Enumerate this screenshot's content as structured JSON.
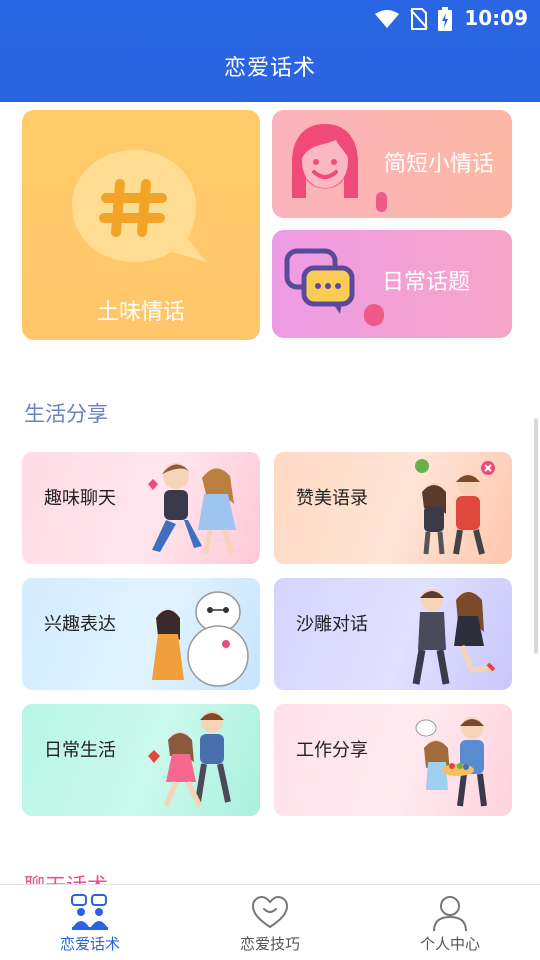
{
  "status_bar": {
    "time": "10:09"
  },
  "app_bar": {
    "title": "恋爱话术"
  },
  "featured": [
    {
      "label": "土味情话"
    },
    {
      "label": "简短小情话"
    },
    {
      "label": "日常话题"
    }
  ],
  "sections": [
    {
      "title": "生活分享",
      "items": [
        {
          "label": "趣味聊天"
        },
        {
          "label": "赞美语录"
        },
        {
          "label": "兴趣表达"
        },
        {
          "label": "沙雕对话"
        },
        {
          "label": "日常生活"
        },
        {
          "label": "工作分享"
        }
      ]
    },
    {
      "title": "聊天话术"
    }
  ],
  "bottom_nav": {
    "items": [
      {
        "label": "恋爱话术",
        "icon": "chat-people-icon",
        "active": true
      },
      {
        "label": "恋爱技巧",
        "icon": "heart-icon",
        "active": false
      },
      {
        "label": "个人中心",
        "icon": "person-icon",
        "active": false
      }
    ]
  },
  "colors": {
    "primary": "#2a63e0",
    "accent_pink": "#ec4c93",
    "section_blue": "#6a82c2"
  }
}
